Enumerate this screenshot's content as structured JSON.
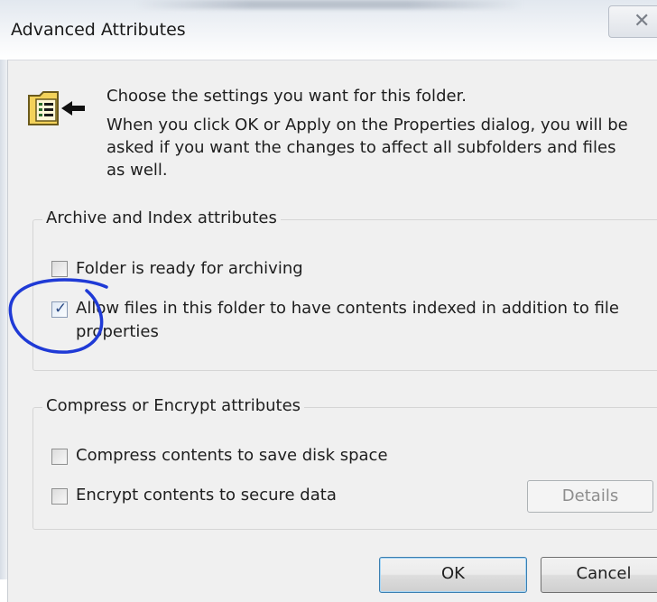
{
  "window": {
    "title": "Advanced Attributes",
    "close_glyph": "✕"
  },
  "intro": {
    "icon": "folder-attributes-icon",
    "heading": "Choose the settings you want for this folder.",
    "line1": "When you click OK or Apply on the Properties dialog, you will be",
    "line2": "asked if you want the changes to affect all subfolders and files",
    "line3": "as well."
  },
  "archive_group": {
    "legend": "Archive and Index attributes",
    "folder_archiving": {
      "label": "Folder is ready for archiving",
      "checked": false
    },
    "allow_indexing": {
      "label_line1": "Allow files in this folder to have contents indexed in addition to file",
      "label_line2": "properties",
      "checked": true
    }
  },
  "compress_group": {
    "legend": "Compress or Encrypt attributes",
    "compress": {
      "label": "Compress contents to save disk space",
      "checked": false
    },
    "encrypt": {
      "label": "Encrypt contents to secure data",
      "checked": false
    },
    "details_label": "Details"
  },
  "footer": {
    "ok_label": "OK",
    "cancel_label": "Cancel"
  },
  "colors": {
    "annotation_circle": "#1f3ad6",
    "dialog_background": "#f0f0f0"
  }
}
